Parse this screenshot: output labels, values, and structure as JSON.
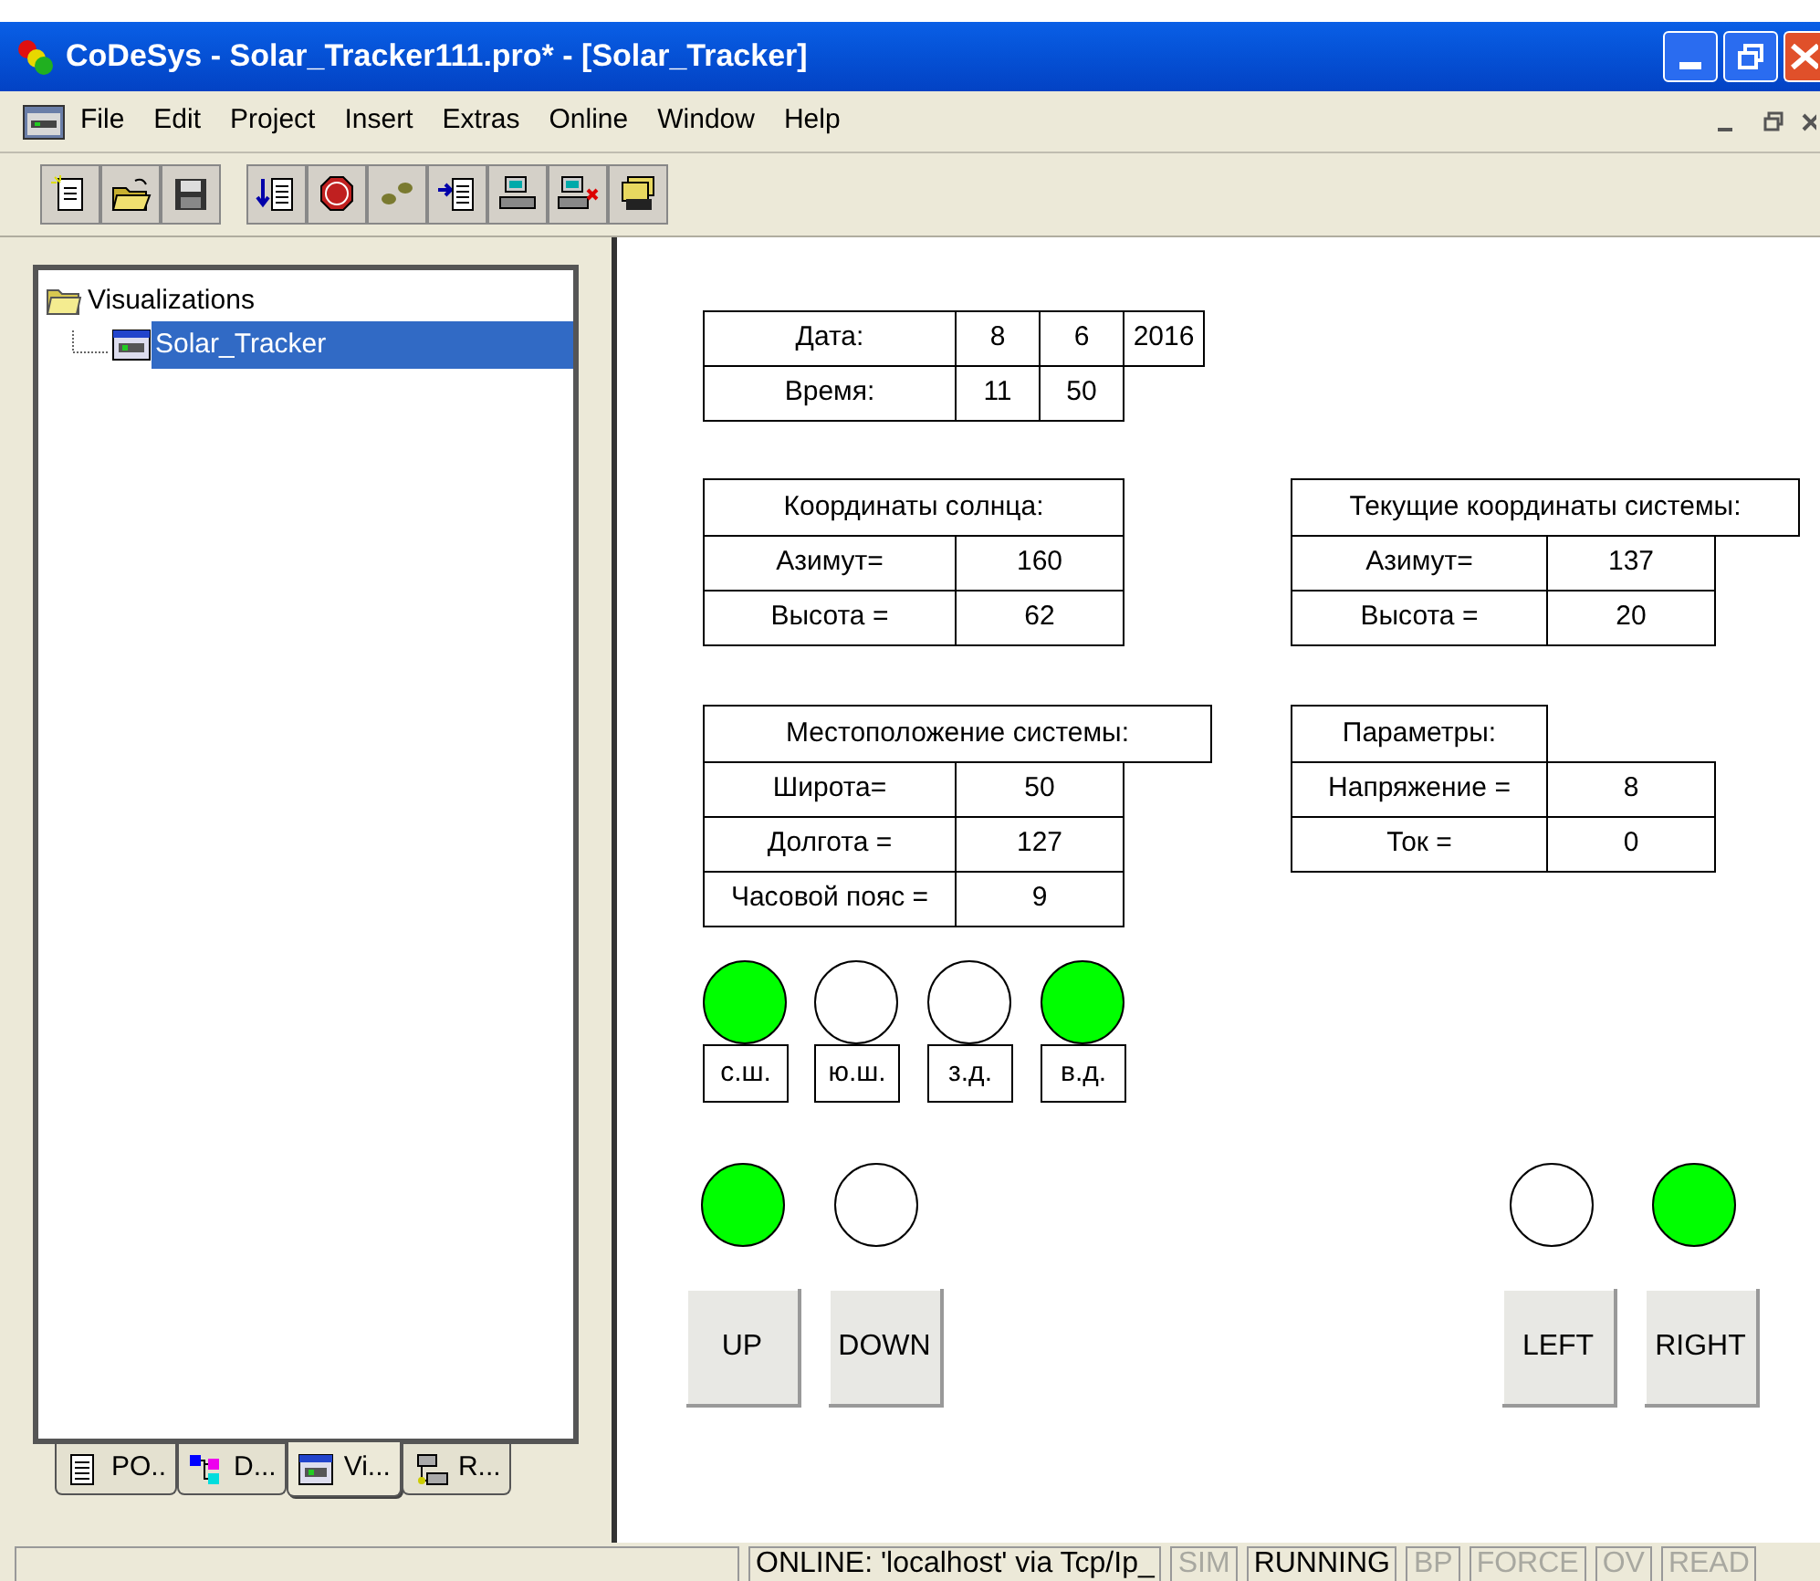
{
  "window": {
    "title": "CoDeSys - Solar_Tracker111.pro* - [Solar_Tracker]"
  },
  "menu": [
    "File",
    "Edit",
    "Project",
    "Insert",
    "Extras",
    "Online",
    "Window",
    "Help"
  ],
  "tree": {
    "label": "Visualizations",
    "children": [
      {
        "label": "Solar_Tracker",
        "selected": true
      }
    ]
  },
  "object_tabs": [
    {
      "label": "PO..",
      "selected": false
    },
    {
      "label": "D...",
      "selected": false
    },
    {
      "label": "Vi...",
      "selected": true
    },
    {
      "label": "R...",
      "selected": false
    }
  ],
  "visualization": {
    "tables": [
      {
        "rows": [
          [
            "Дата:",
            "8",
            "6",
            "2016"
          ],
          [
            "Время:",
            "11",
            "50"
          ]
        ]
      },
      {
        "header": "Координаты солнца:",
        "rows": [
          [
            "Азимут=",
            "160"
          ],
          [
            "Высота =",
            "62"
          ]
        ]
      },
      {
        "header": "Текущие координаты системы:",
        "rows": [
          [
            "Азимут=",
            "137"
          ],
          [
            "Высота =",
            "20"
          ]
        ]
      },
      {
        "header": "Местоположение системы:",
        "rows": [
          [
            "Широта=",
            "50"
          ],
          [
            "Долгота =",
            "127"
          ],
          [
            "Часовой пояс =",
            "9"
          ]
        ]
      },
      {
        "header": "Параметры:",
        "rows": [
          [
            "Напряжение =",
            "8"
          ],
          [
            "Ток =",
            "0"
          ]
        ]
      }
    ],
    "direction_lamps": [
      {
        "label": "с.ш.",
        "on": true
      },
      {
        "label": "ю.ш.",
        "on": false
      },
      {
        "label": "з.д.",
        "on": false
      },
      {
        "label": "в.д.",
        "on": true
      }
    ],
    "motor_controls": [
      {
        "label": "UP",
        "on": true
      },
      {
        "label": "DOWN",
        "on": false
      },
      {
        "label": "LEFT",
        "on": false
      },
      {
        "label": "RIGHT",
        "on": true
      }
    ]
  },
  "status_bar": [
    {
      "text": "ONLINE: 'localhost' via Tcp/Ip_",
      "enabled": true
    },
    {
      "text": "SIM",
      "enabled": false
    },
    {
      "text": "RUNNING",
      "enabled": true
    },
    {
      "text": "BP",
      "enabled": false
    },
    {
      "text": "FORCE",
      "enabled": false
    },
    {
      "text": "OV",
      "enabled": false
    },
    {
      "text": "READ",
      "enabled": false
    }
  ]
}
